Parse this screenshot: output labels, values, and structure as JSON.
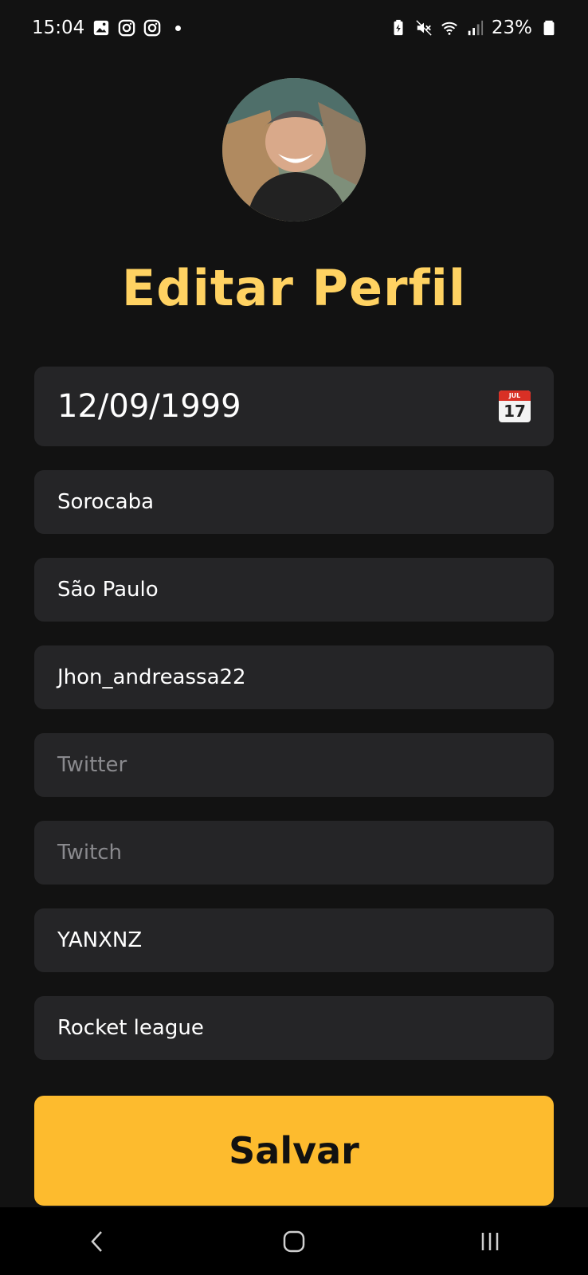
{
  "status_bar": {
    "time": "15:04",
    "battery": "23%",
    "icons_left": [
      "gallery-icon",
      "instagram-icon",
      "instagram-icon",
      "notification-dot"
    ],
    "icons_right": [
      "battery-saver-icon",
      "mute-icon",
      "wifi-icon",
      "signal-icon",
      "battery-icon"
    ]
  },
  "header": {
    "title": "Editar Perfil"
  },
  "form": {
    "birth_date": "12/09/1999",
    "calendar_month": "JUL",
    "calendar_day": "17",
    "city": "Sorocaba",
    "state": "São Paulo",
    "instagram": "Jhon_andreassa22",
    "twitter_placeholder": "Twitter",
    "twitch_placeholder": "Twitch",
    "nickname": "YANXNZ",
    "favorite_game": "Rocket league"
  },
  "actions": {
    "save_label": "Salvar"
  },
  "colors": {
    "background": "#121212",
    "field": "#252527",
    "title": "#ffd262",
    "button": "#fdbb2e"
  }
}
